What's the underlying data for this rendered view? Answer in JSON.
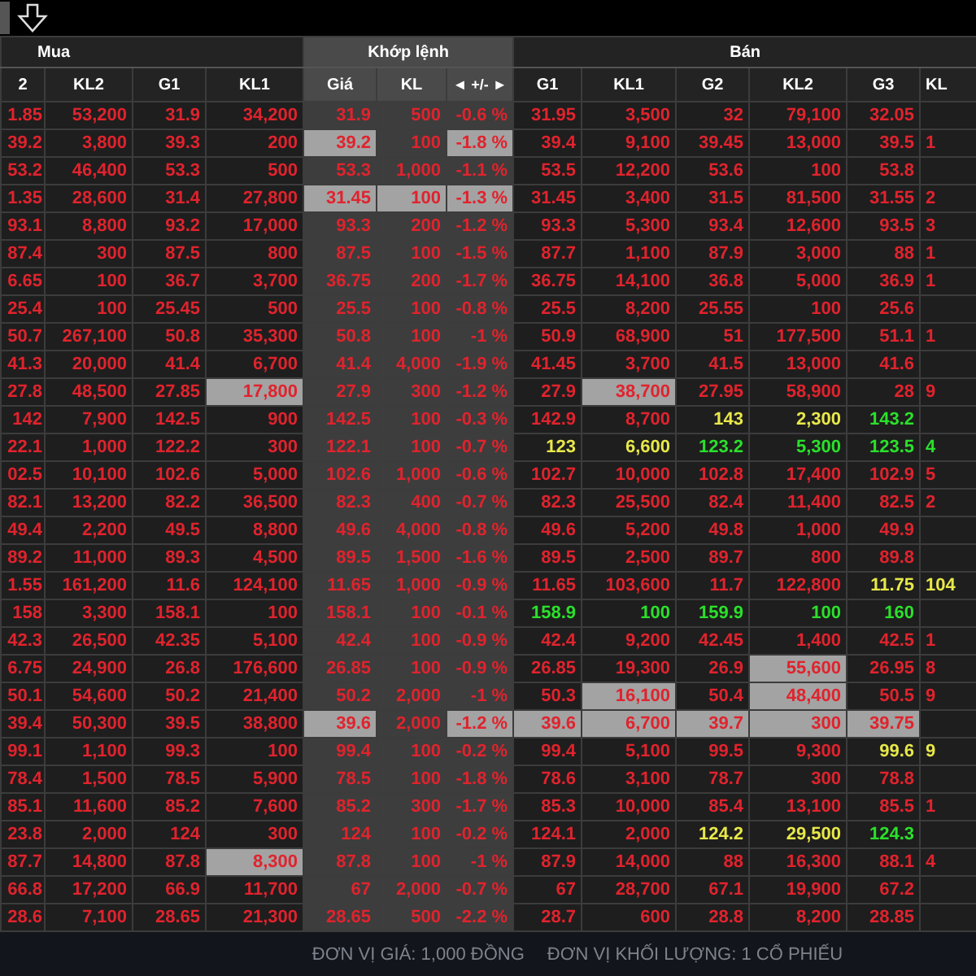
{
  "groups": [
    {
      "label": "Mua",
      "kind": "buy",
      "columns": [
        "2",
        "KL2",
        "G1",
        "KL1"
      ]
    },
    {
      "label": "Khớp lệnh",
      "kind": "match",
      "columns": [
        "Giá",
        "KL",
        "◄ +/- ►"
      ]
    },
    {
      "label": "Bán",
      "kind": "sell",
      "columns": [
        "G1",
        "KL1",
        "G2",
        "KL2",
        "G3",
        "KL"
      ]
    }
  ],
  "rows": [
    {
      "cells": [
        "1.85",
        "53,200",
        "31.9",
        "34,200",
        "31.9",
        "500",
        "-0.6 %",
        "31.95",
        "3,500",
        "32",
        "79,100",
        "32.05",
        null
      ]
    },
    {
      "cells": [
        "39.2",
        "3,800",
        "39.3",
        "200",
        {
          "text": "39.2",
          "highlighted": true
        },
        "100",
        {
          "text": "-1.8 %",
          "highlighted": true
        },
        "39.4",
        "9,100",
        "39.45",
        "13,000",
        "39.5",
        "1"
      ]
    },
    {
      "cells": [
        "53.2",
        "46,400",
        "53.3",
        "500",
        "53.3",
        "1,000",
        "-1.1 %",
        "53.5",
        "12,200",
        "53.6",
        "100",
        "53.8",
        null
      ]
    },
    {
      "cells": [
        "1.35",
        "28,600",
        "31.4",
        "27,800",
        {
          "text": "31.45",
          "highlighted": true
        },
        {
          "text": "100",
          "highlighted": true
        },
        {
          "text": "-1.3 %",
          "highlighted": true
        },
        "31.45",
        "3,400",
        "31.5",
        "81,500",
        "31.55",
        "2"
      ]
    },
    {
      "cells": [
        "93.1",
        "8,800",
        "93.2",
        "17,000",
        "93.3",
        "200",
        "-1.2 %",
        "93.3",
        "5,300",
        "93.4",
        "12,600",
        "93.5",
        "3"
      ]
    },
    {
      "cells": [
        "87.4",
        "300",
        "87.5",
        "800",
        "87.5",
        "100",
        "-1.5 %",
        "87.7",
        "1,100",
        "87.9",
        "3,000",
        "88",
        "1"
      ]
    },
    {
      "cells": [
        "6.65",
        "100",
        "36.7",
        "3,700",
        "36.75",
        "200",
        "-1.7 %",
        "36.75",
        "14,100",
        "36.8",
        "5,000",
        "36.9",
        "1"
      ]
    },
    {
      "cells": [
        "25.4",
        "100",
        "25.45",
        "500",
        "25.5",
        "100",
        "-0.8 %",
        "25.5",
        "8,200",
        "25.55",
        "100",
        "25.6",
        null
      ]
    },
    {
      "cells": [
        "50.7",
        "267,100",
        "50.8",
        "35,300",
        "50.8",
        "100",
        "-1 %",
        "50.9",
        "68,900",
        "51",
        "177,500",
        "51.1",
        "1"
      ]
    },
    {
      "cells": [
        "41.3",
        "20,000",
        "41.4",
        "6,700",
        "41.4",
        "4,000",
        "-1.9 %",
        "41.45",
        "3,700",
        "41.5",
        "13,000",
        "41.6",
        null
      ]
    },
    {
      "cells": [
        "27.8",
        "48,500",
        "27.85",
        {
          "text": "17,800",
          "highlighted": true
        },
        "27.9",
        "300",
        "-1.2 %",
        "27.9",
        {
          "text": "38,700",
          "highlighted": true
        },
        "27.95",
        "58,900",
        "28",
        "9"
      ]
    },
    {
      "cells": [
        "142",
        "7,900",
        "142.5",
        "900",
        "142.5",
        "100",
        "-0.3 %",
        "142.9",
        "8,700",
        {
          "text": "143",
          "color": "#e8e84a"
        },
        {
          "text": "2,300",
          "color": "#e8e84a"
        },
        {
          "text": "143.2",
          "color": "#2be02b"
        },
        null
      ]
    },
    {
      "cells": [
        "22.1",
        "1,000",
        "122.2",
        "300",
        "122.1",
        "100",
        "-0.7 %",
        {
          "text": "123",
          "color": "#e8e84a"
        },
        {
          "text": "6,600",
          "color": "#e8e84a"
        },
        {
          "text": "123.2",
          "color": "#2be02b"
        },
        {
          "text": "5,300",
          "color": "#2be02b"
        },
        {
          "text": "123.5",
          "color": "#2be02b"
        },
        {
          "text": "4",
          "color": "#2be02b"
        }
      ]
    },
    {
      "cells": [
        "02.5",
        "10,100",
        "102.6",
        "5,000",
        "102.6",
        "1,000",
        "-0.6 %",
        "102.7",
        "10,000",
        "102.8",
        "17,400",
        "102.9",
        "5"
      ]
    },
    {
      "cells": [
        "82.1",
        "13,200",
        "82.2",
        "36,500",
        "82.3",
        "400",
        "-0.7 %",
        "82.3",
        "25,500",
        "82.4",
        "11,400",
        "82.5",
        "2"
      ]
    },
    {
      "cells": [
        "49.4",
        "2,200",
        "49.5",
        "8,800",
        "49.6",
        "4,000",
        "-0.8 %",
        "49.6",
        "5,200",
        "49.8",
        "1,000",
        "49.9",
        null
      ]
    },
    {
      "cells": [
        "89.2",
        "11,000",
        "89.3",
        "4,500",
        "89.5",
        "1,500",
        "-1.6 %",
        "89.5",
        "2,500",
        "89.7",
        "800",
        "89.8",
        null
      ]
    },
    {
      "cells": [
        "1.55",
        "161,200",
        "11.6",
        "124,100",
        "11.65",
        "1,000",
        "-0.9 %",
        "11.65",
        "103,600",
        "11.7",
        "122,800",
        {
          "text": "11.75",
          "color": "#e8e84a"
        },
        {
          "text": "104",
          "color": "#e8e84a"
        }
      ]
    },
    {
      "cells": [
        "158",
        "3,300",
        "158.1",
        "100",
        "158.1",
        "100",
        "-0.1 %",
        {
          "text": "158.9",
          "color": "#2be02b"
        },
        {
          "text": "100",
          "color": "#2be02b"
        },
        {
          "text": "159.9",
          "color": "#2be02b"
        },
        {
          "text": "100",
          "color": "#2be02b"
        },
        {
          "text": "160",
          "color": "#2be02b"
        },
        null
      ]
    },
    {
      "cells": [
        "42.3",
        "26,500",
        "42.35",
        "5,100",
        "42.4",
        "100",
        "-0.9 %",
        "42.4",
        "9,200",
        "42.45",
        "1,400",
        "42.5",
        "1"
      ]
    },
    {
      "cells": [
        "6.75",
        "24,900",
        "26.8",
        "176,600",
        "26.85",
        "100",
        "-0.9 %",
        "26.85",
        "19,300",
        "26.9",
        {
          "text": "55,600",
          "highlighted": true
        },
        "26.95",
        "8"
      ]
    },
    {
      "cells": [
        "50.1",
        "54,600",
        "50.2",
        "21,400",
        "50.2",
        "2,000",
        "-1 %",
        "50.3",
        {
          "text": "16,100",
          "highlighted": true
        },
        "50.4",
        {
          "text": "48,400",
          "highlighted": true
        },
        "50.5",
        "9"
      ]
    },
    {
      "cells": [
        "39.4",
        "50,300",
        "39.5",
        "38,800",
        {
          "text": "39.6",
          "highlighted": true
        },
        "2,000",
        {
          "text": "-1.2 %",
          "highlighted": true
        },
        {
          "text": "39.6",
          "highlighted": true
        },
        {
          "text": "6,700",
          "highlighted": true
        },
        {
          "text": "39.7",
          "highlighted": true
        },
        {
          "text": "300",
          "highlighted": true
        },
        {
          "text": "39.75",
          "highlighted": true
        },
        null
      ]
    },
    {
      "cells": [
        "99.1",
        "1,100",
        "99.3",
        "100",
        "99.4",
        "100",
        "-0.2 %",
        "99.4",
        "5,100",
        "99.5",
        "9,300",
        {
          "text": "99.6",
          "color": "#e8e84a"
        },
        {
          "text": "9",
          "color": "#e8e84a"
        }
      ]
    },
    {
      "cells": [
        "78.4",
        "1,500",
        "78.5",
        "5,900",
        "78.5",
        "100",
        "-1.8 %",
        "78.6",
        "3,100",
        "78.7",
        "300",
        "78.8",
        null
      ]
    },
    {
      "cells": [
        "85.1",
        "11,600",
        "85.2",
        "7,600",
        "85.2",
        "300",
        "-1.7 %",
        "85.3",
        "10,000",
        "85.4",
        "13,100",
        "85.5",
        "1"
      ]
    },
    {
      "cells": [
        "23.8",
        "2,000",
        "124",
        "300",
        "124",
        "100",
        "-0.2 %",
        "124.1",
        "2,000",
        {
          "text": "124.2",
          "color": "#e8e84a"
        },
        {
          "text": "29,500",
          "color": "#e8e84a"
        },
        {
          "text": "124.3",
          "color": "#2be02b"
        },
        null
      ]
    },
    {
      "cells": [
        "87.7",
        "14,800",
        "87.8",
        {
          "text": "8,300",
          "highlighted": true
        },
        "87.8",
        "100",
        "-1 %",
        "87.9",
        "14,000",
        "88",
        "16,300",
        "88.1",
        "4"
      ]
    },
    {
      "cells": [
        "66.8",
        "17,200",
        "66.9",
        "11,700",
        "67",
        "2,000",
        "-0.7 %",
        "67",
        "28,700",
        "67.1",
        "19,900",
        "67.2",
        null
      ]
    },
    {
      "cells": [
        "28.6",
        "7,100",
        "28.65",
        "21,300",
        "28.65",
        "500",
        "-2.2 %",
        "28.7",
        "600",
        "28.8",
        "8,200",
        "28.85",
        null
      ]
    }
  ],
  "footer": [
    "ĐƠN VỊ GIÁ: 1,000 ĐỒNG",
    "ĐƠN VỊ KHỐI LƯỢNG: 1 CỔ PHIẾU"
  ]
}
